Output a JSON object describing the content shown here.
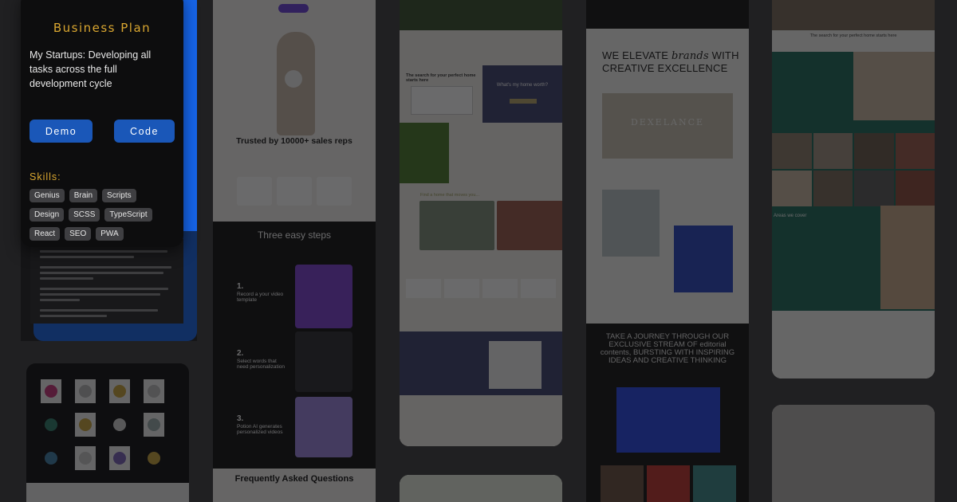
{
  "panel": {
    "title": "Business Plan",
    "description": "My Startups: Developing all tasks across the full development cycle",
    "demo_label": "Demo",
    "code_label": "Code",
    "skills_title": "Skills:",
    "skills": [
      "Genius",
      "Brain",
      "Scripts",
      "Design",
      "SCSS",
      "TypeScript",
      "React",
      "SEO",
      "PWA"
    ],
    "accent_color": "#d9a630",
    "button_color": "#1a57b8"
  },
  "previews": {
    "sales": {
      "trusted": "Trusted by 10000+ sales reps",
      "three_steps": "Three easy steps",
      "step1": "Record a your video template",
      "step2": "Select words that need personalization",
      "step3": "Potion AI generates personalized videos",
      "faq": "Frequently Asked Questions"
    },
    "homes": {
      "search_title": "The search for your perfect home starts here",
      "worth": "What's my home worth?",
      "find": "Find a home that moves you..."
    },
    "creative": {
      "headline_a": "WE ELEVATE",
      "headline_b": "brands",
      "headline_c": "WITH CREATIVE EXCELLENCE",
      "hero_brand": "DEXELANCE",
      "journey": "TAKE A JOURNEY THROUGH OUR EXCLUSIVE STREAM OF editorial contents, BURSTING WITH INSPIRING IDEAS AND CREATIVE THINKING"
    },
    "agency": {
      "search_title": "The search for your perfect home starts here",
      "areas": "Areas we cover"
    }
  }
}
